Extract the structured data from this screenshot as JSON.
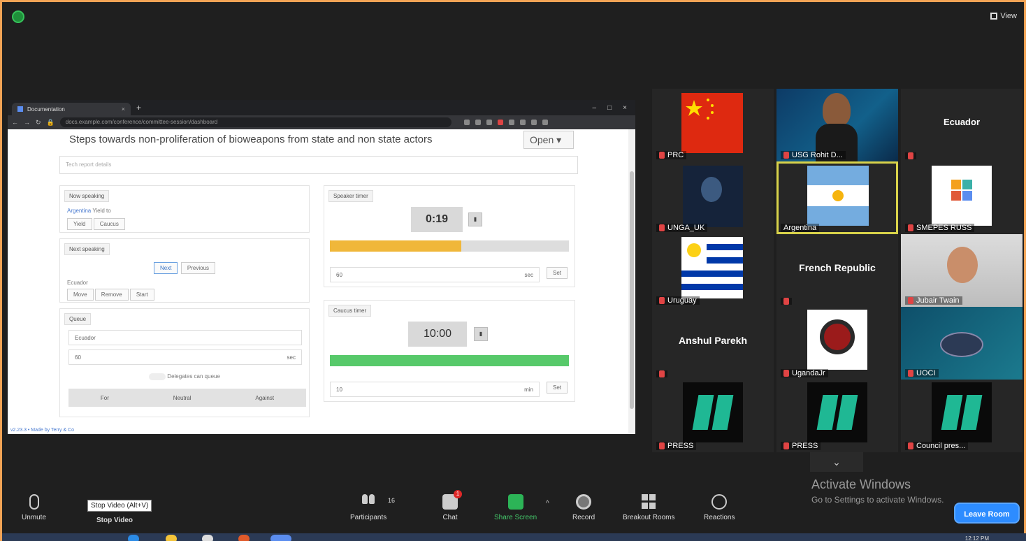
{
  "window": {
    "view_label": "View"
  },
  "browser": {
    "tab_title": "Documentation",
    "url": "docs.example.com/conference/committee-session/dashboard"
  },
  "session": {
    "topic": "Steps towards non-proliferation of bioweapons from state and non state actors",
    "status_select": "Open",
    "notes_placeholder": "Tech report details",
    "now_speaking": {
      "title": "Now speaking",
      "country": "Argentina",
      "status": "Yield to",
      "actions": [
        "Yield",
        "Caucus"
      ]
    },
    "next_speaking": {
      "title": "Next speaking",
      "buttons": [
        "Next",
        "Previous"
      ],
      "country": "Ecuador",
      "actions": [
        "Move",
        "Remove",
        "Start"
      ]
    },
    "queue": {
      "title": "Queue",
      "country_field": "Ecuador",
      "time_field": "60",
      "unit": "sec",
      "checkbox_label": "Delegates can queue",
      "vote_options": [
        "For",
        "Neutral",
        "Against"
      ]
    },
    "speaker_timer": {
      "title": "Speaker timer",
      "value": "0:19",
      "progress": 0.55,
      "bar_color": "#f0b73a",
      "duration": "60",
      "unit": "sec",
      "set_label": "Set"
    },
    "caucus_timer": {
      "title": "Caucus timer",
      "value": "10:00",
      "progress": 1.0,
      "bar_color": "#57c96a",
      "duration": "10",
      "unit": "min",
      "set_label": "Set"
    },
    "footer_link": "v2.23.3 • Made by Terry & Co"
  },
  "participants": [
    {
      "name": "PRC",
      "kind": "flag-china"
    },
    {
      "name": "USG Rohit D...",
      "kind": "video"
    },
    {
      "name": "",
      "display": "Ecuador",
      "kind": "text"
    },
    {
      "name": "UNGA_UK",
      "kind": "video"
    },
    {
      "name": "Argentina",
      "kind": "flag-argentina",
      "active": true
    },
    {
      "name": "SMEPES RUSS",
      "kind": "logo"
    },
    {
      "name": "Uruguay",
      "kind": "flag-uruguay"
    },
    {
      "name": "",
      "display": "French Republic",
      "kind": "text"
    },
    {
      "name": "Jubair Twain",
      "kind": "video"
    },
    {
      "name": "",
      "display": "Anshul Parekh",
      "kind": "text"
    },
    {
      "name": "UgandaJr",
      "kind": "emblem"
    },
    {
      "name": "UOCI",
      "kind": "slide"
    },
    {
      "name": "PRESS",
      "kind": "huffpost"
    },
    {
      "name": "PRESS",
      "kind": "huffpost"
    },
    {
      "name": "Council pres...",
      "kind": "huffpost"
    }
  ],
  "toolbar": {
    "unmute": "Unmute",
    "stop_video": "Stop Video",
    "stop_video_tip": "Stop Video (Alt+V)",
    "participants": "Participants",
    "participants_count": "16",
    "chat": "Chat",
    "chat_badge": "1",
    "share_screen": "Share Screen",
    "record": "Record",
    "breakout": "Breakout Rooms",
    "reactions": "Reactions",
    "leave": "Leave Room"
  },
  "watermark": {
    "title": "Activate Windows",
    "subtitle": "Go to Settings to activate Windows."
  },
  "taskbar": {
    "clock": "12:12 PM"
  },
  "colors": {
    "accent": "#2d8cff",
    "active_border": "#d8d24a",
    "page_border": "#f2a355"
  }
}
